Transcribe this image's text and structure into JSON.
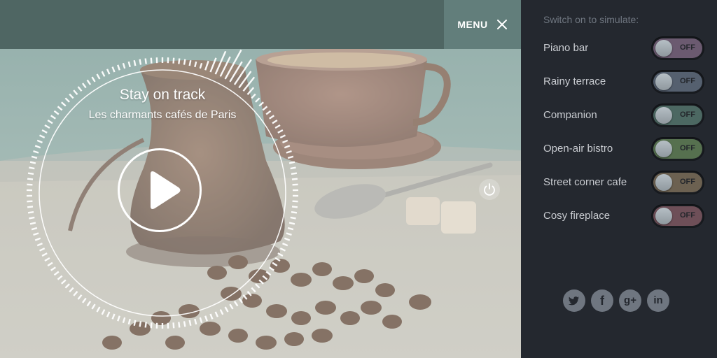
{
  "header": {
    "menu_label": "MENU"
  },
  "player": {
    "title": "Stay on track",
    "subtitle": "Les charmants cafés de Paris"
  },
  "sidebar": {
    "heading": "Switch on to simulate:",
    "items": [
      {
        "label": "Piano bar",
        "state": "OFF",
        "color": "#6b5a70"
      },
      {
        "label": "Rainy terrace",
        "state": "OFF",
        "color": "#55606f"
      },
      {
        "label": "Companion",
        "state": "OFF",
        "color": "#4c6862"
      },
      {
        "label": "Open-air bistro",
        "state": "OFF",
        "color": "#56704f"
      },
      {
        "label": "Street corner cafe",
        "state": "OFF",
        "color": "#6c6151"
      },
      {
        "label": "Cosy fireplace",
        "state": "OFF",
        "color": "#6e4f58"
      }
    ]
  },
  "social": {
    "twitter": "twitter-icon",
    "facebook": "f",
    "googleplus": "g+",
    "linkedin": "in"
  },
  "colors": {
    "topbar": "#4f6663",
    "menu_button": "#627e7b",
    "sidebar_bg": "#24282f",
    "social_icon": "#6f7680"
  }
}
